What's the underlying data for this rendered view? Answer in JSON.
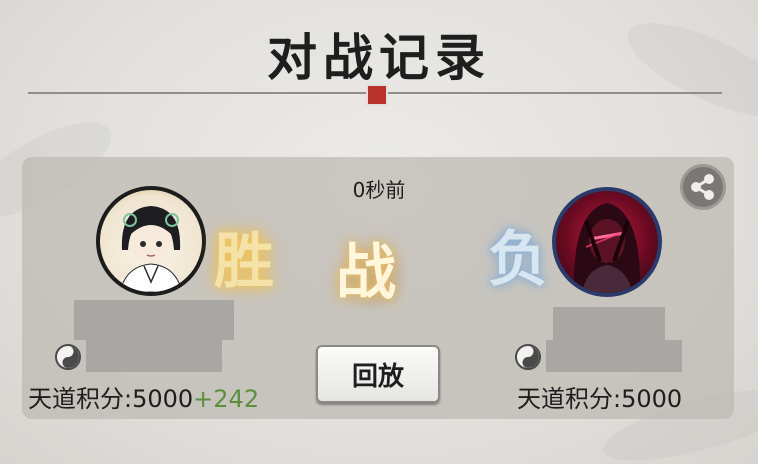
{
  "title": "对战记录",
  "match": {
    "time_ago": "0秒前",
    "vs_label": "战",
    "replay_label": "回放"
  },
  "left_player": {
    "result": "胜",
    "score_label": "天道积分:5000",
    "score_delta": "+242"
  },
  "right_player": {
    "result": "负",
    "score_label": "天道积分:5000"
  },
  "icons": {
    "share": "share-icon",
    "taiji": "taiji-icon",
    "seal": "seal-icon"
  },
  "colors": {
    "win_glow": "#f3c75a",
    "lose_glow": "#8fb3d9",
    "score_delta": "#5c8f3c"
  }
}
